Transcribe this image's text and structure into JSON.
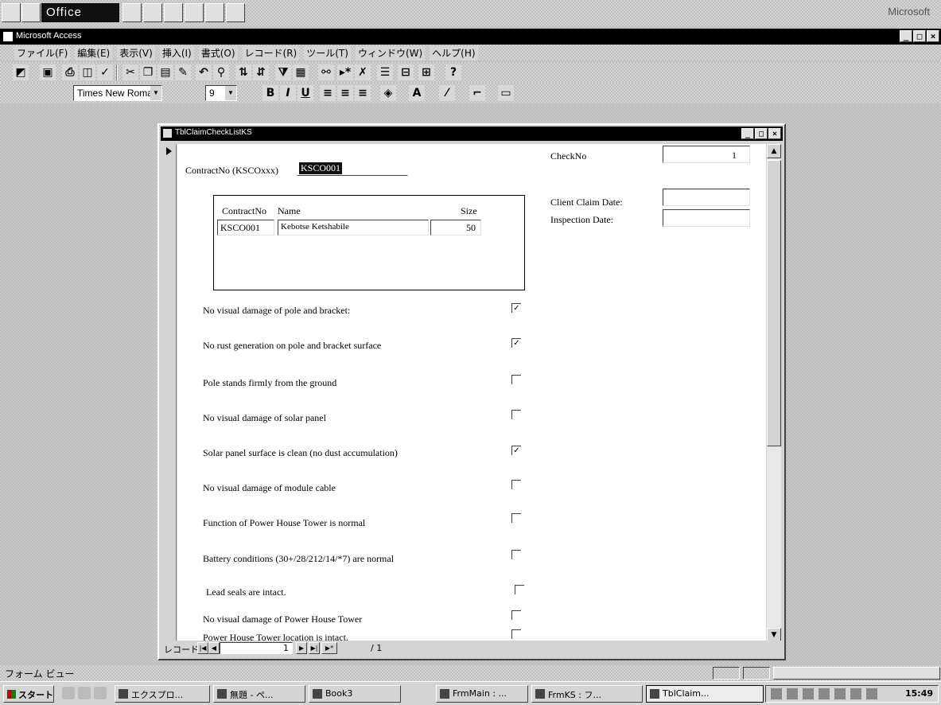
{
  "office_bar": {
    "label": "Office",
    "right_label": "Microsoft"
  },
  "access_window": {
    "title": "Microsoft Access"
  },
  "window_buttons": {
    "minimize": "_",
    "maximize": "□",
    "close": "×"
  },
  "menu": [
    "ファイル(F)",
    "編集(E)",
    "表示(V)",
    "挿入(I)",
    "書式(O)",
    "レコード(R)",
    "ツール(T)",
    "ウィンドウ(W)",
    "ヘルプ(H)"
  ],
  "formatting": {
    "font_name": "Times New Roman",
    "font_size": "9"
  },
  "form": {
    "title": "TblClaimCheckListKS",
    "contract_label": "ContractNo (KSCOxxx)",
    "contract_value": "KSCO001",
    "checkno_label": "CheckNo",
    "checkno_value": "1",
    "client_claim_label": "Client Claim Date:",
    "client_claim_value": "",
    "inspection_label": "Inspection Date:",
    "inspection_value": "",
    "subform": {
      "headers": [
        "ContractNo",
        "Name",
        "Size"
      ],
      "rows": [
        {
          "contract": "KSCO001",
          "name": "Kebotse Ketshabile",
          "size": "50"
        }
      ]
    },
    "checklist": [
      {
        "label": "No visual damage of pole and bracket:",
        "checked": true
      },
      {
        "label": "No rust generation on pole and bracket surface",
        "checked": true
      },
      {
        "label": "Pole stands firmly from the ground",
        "checked": false
      },
      {
        "label": "No visual damage of solar panel",
        "checked": false
      },
      {
        "label": "Solar panel surface is clean (no dust accumulation)",
        "checked": true
      },
      {
        "label": "No visual damage of module cable",
        "checked": false
      },
      {
        "label": "Function of Power House Tower is normal",
        "checked": false
      },
      {
        "label": "Battery conditions (30+/28/212/14/*7) are normal",
        "checked": false
      },
      {
        "label": "Lead seals are intact.",
        "checked": false
      },
      {
        "label": "No visual damage of Power House Tower",
        "checked": false
      },
      {
        "label": "Power House Tower location is intact.",
        "checked": false
      }
    ],
    "check_mark": "✓",
    "navigation": {
      "label": "レコード:",
      "current": "1",
      "total": "/ 1",
      "first": "|◀",
      "prev": "◀",
      "next": "▶",
      "last": "▶|",
      "new": "▶*"
    }
  },
  "status_bar": {
    "text": "フォーム ビュー"
  },
  "taskbar": {
    "start": "スタート",
    "tasks": [
      "エクスプロ...",
      "無題 - ペ...",
      "Book3",
      "FrmMain : ...",
      "FrmKS : フ...",
      "TblClaim..."
    ],
    "clock": "15:49"
  }
}
